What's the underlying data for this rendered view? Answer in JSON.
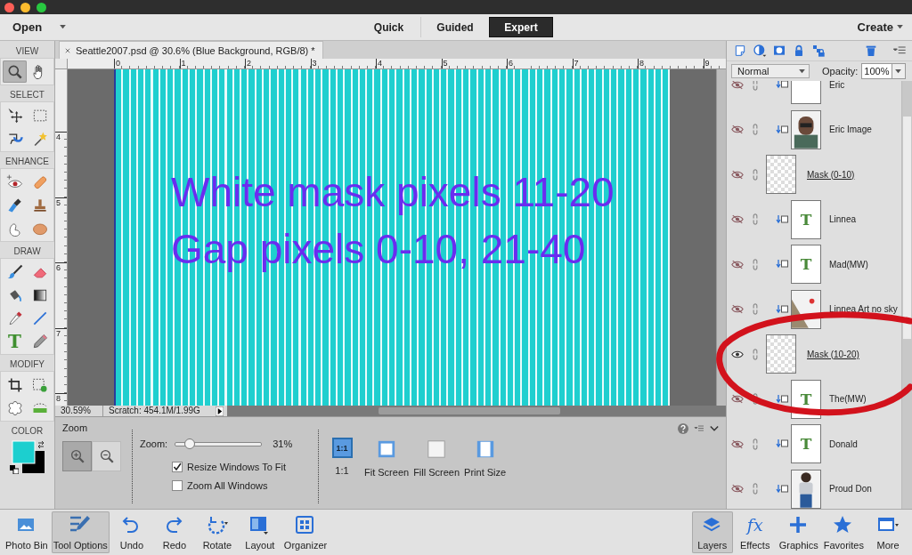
{
  "window": {
    "controls": [
      {
        "color": "#fc5f57"
      },
      {
        "color": "#fdbc2e"
      },
      {
        "color": "#28c840"
      }
    ]
  },
  "top_bar": {
    "open": "Open",
    "create": "Create",
    "modes": [
      {
        "label": "Quick",
        "selected": false
      },
      {
        "label": "Guided",
        "selected": false
      },
      {
        "label": "Expert",
        "selected": true
      }
    ]
  },
  "toolbox": {
    "sections": [
      {
        "label": "VIEW",
        "tools": [
          {
            "selected": true
          },
          {
            "selected": false
          }
        ]
      },
      {
        "label": "SELECT",
        "tools": [
          {
            "selected": false
          },
          {
            "selected": false
          },
          {
            "selected": false
          },
          {
            "selected": false
          }
        ]
      },
      {
        "label": "ENHANCE",
        "tools": [
          {
            "selected": false
          },
          {
            "selected": false
          },
          {
            "selected": false
          },
          {
            "selected": false
          },
          {
            "selected": false
          },
          {
            "selected": false
          }
        ]
      },
      {
        "label": "DRAW",
        "tools": [
          {
            "selected": false
          },
          {
            "selected": false
          },
          {
            "selected": false
          },
          {
            "selected": false
          },
          {
            "selected": false
          },
          {
            "selected": false
          },
          {
            "glyph": "T",
            "selected": false
          },
          {
            "selected": false
          }
        ]
      },
      {
        "label": "MODIFY",
        "tools": [
          {
            "selected": false
          },
          {
            "selected": false
          },
          {
            "selected": false
          },
          {
            "selected": false
          }
        ]
      }
    ],
    "color_label": "COLOR",
    "swatches": [
      {
        "color": "#1ccfcf"
      },
      {
        "color": "#000000"
      }
    ]
  },
  "document": {
    "tab_title": "Seattle2007.psd @ 30.6% (Blue Background, RGB/8) *",
    "ruler_h": [
      "0",
      "1",
      "2",
      "3",
      "4",
      "5",
      "6",
      "7",
      "8",
      "9"
    ],
    "ruler_v": [
      "4",
      "5",
      "6",
      "7",
      "8"
    ],
    "canvas_lines": [
      "White mask pixels 11-20",
      "Gap pixels 0-10, 21-40"
    ],
    "zoom_readout": "30.59%",
    "scratch": "Scratch: 454.1M/1.99G"
  },
  "tool_options": {
    "title": "Zoom",
    "zoom_buttons": [
      {
        "selected": true
      },
      {
        "selected": false
      }
    ],
    "zoom_label": "Zoom:",
    "zoom_slider": {
      "level": 0.15
    },
    "zoom_value": "31%",
    "options": [
      {
        "label": "Resize Windows To Fit",
        "checked": true
      },
      {
        "label": "Zoom All Windows",
        "checked": false
      }
    ],
    "views": [
      {
        "label": "1:1",
        "glyph": "1:1",
        "selected": true
      },
      {
        "label": "Fit Screen",
        "selected": false
      },
      {
        "label": "Fill Screen",
        "selected": false
      },
      {
        "label": "Print Size",
        "selected": false
      }
    ]
  },
  "layers_panel": {
    "blend_mode": "Normal",
    "opacity_label": "Opacity:",
    "opacity": "100%",
    "layers": [
      {
        "name": "Eric",
        "kind": "text",
        "visible": false
      },
      {
        "name": "Eric Image",
        "visible": false
      },
      {
        "name": "Mask (0-10)",
        "kind": "mask",
        "visible": false
      },
      {
        "name": "Linnea",
        "kind": "text",
        "glyph": "T",
        "visible": false
      },
      {
        "name": "Mad(MW)",
        "kind": "text",
        "glyph": "T",
        "visible": false
      },
      {
        "name": "Linnea Art no sky",
        "visible": false
      },
      {
        "name": "Mask (10-20)",
        "kind": "mask",
        "visible": true
      },
      {
        "name": "The(MW)",
        "kind": "text",
        "glyph": "T",
        "visible": false
      },
      {
        "name": "Donald",
        "kind": "text",
        "glyph": "T",
        "visible": false
      },
      {
        "name": "Proud Don",
        "visible": false
      }
    ]
  },
  "bottom_bar": {
    "left": [
      {
        "label": "Photo Bin",
        "selected": false
      },
      {
        "label": "Tool Options",
        "selected": true
      },
      {
        "label": "Undo",
        "selected": false
      },
      {
        "label": "Redo",
        "selected": false
      },
      {
        "label": "Rotate",
        "selected": false
      },
      {
        "label": "Layout",
        "selected": false
      },
      {
        "label": "Organizer",
        "selected": false
      }
    ],
    "right": [
      {
        "label": "Layers",
        "selected": true
      },
      {
        "label": "Effects",
        "glyph": "fx",
        "selected": false
      },
      {
        "label": "Graphics",
        "selected": false
      },
      {
        "label": "Favorites",
        "selected": false
      },
      {
        "label": "More",
        "selected": false
      }
    ]
  }
}
